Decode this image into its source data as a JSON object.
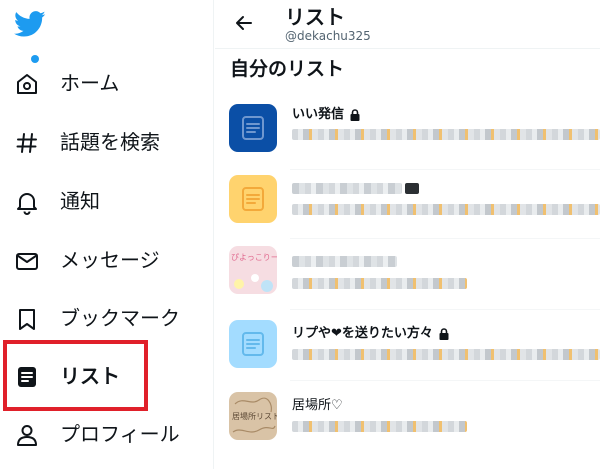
{
  "sidebar": {
    "items": [
      {
        "id": "home",
        "label": "ホーム",
        "icon": "home-icon"
      },
      {
        "id": "explore",
        "label": "話題を検索",
        "icon": "hashtag-icon"
      },
      {
        "id": "notifications",
        "label": "通知",
        "icon": "bell-icon"
      },
      {
        "id": "messages",
        "label": "メッセージ",
        "icon": "envelope-icon"
      },
      {
        "id": "bookmarks",
        "label": "ブックマーク",
        "icon": "bookmark-icon"
      },
      {
        "id": "lists",
        "label": "リスト",
        "icon": "list-icon",
        "active": true
      },
      {
        "id": "profile",
        "label": "プロフィール",
        "icon": "person-icon"
      }
    ],
    "notification_dot_color": "#1d9bf0",
    "highlight_color": "#e0202a"
  },
  "header": {
    "title": "リスト",
    "handle": "@dekachu325"
  },
  "section_title": "自分のリスト",
  "lists": [
    {
      "name": "いい発信",
      "private": true,
      "thumb_color": "#0b4fa6",
      "name_visible": true
    },
    {
      "name": "",
      "private": false,
      "thumb_color": "#ffd36e",
      "name_visible": false
    },
    {
      "name": "",
      "private": false,
      "thumb_color": "#f6dde2",
      "thumb_caption": "ぴよっこりー",
      "name_visible": false
    },
    {
      "name": "リプや❤を送りたい方々",
      "private": true,
      "thumb_color": "#a3dcff",
      "name_visible": true
    },
    {
      "name": "居場所♡",
      "private": false,
      "thumb_color": "#d9c3a6",
      "thumb_caption": "居場所リスト",
      "name_visible": true
    }
  ],
  "colors": {
    "brand": "#1d9bf0",
    "text": "#0f1419",
    "muted": "#536471"
  }
}
